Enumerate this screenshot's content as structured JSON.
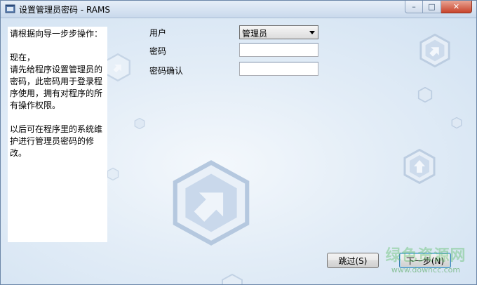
{
  "window": {
    "title": "设置管理员密码 - RAMS",
    "minimize_glyph": "–",
    "maximize_glyph": "□",
    "close_glyph": "✕"
  },
  "instructions": {
    "line1": "请根据向导一步步操作：",
    "line2": "现在，\n请先给程序设置管理员的密码，此密码用于登录程序使用，拥有对程序的所有操作权限。",
    "line3": "以后可在程序里的系统维护进行管理员密码的修改。"
  },
  "form": {
    "user_label": "用户",
    "user_value": "管理员",
    "password_label": "密码",
    "password_value": "",
    "confirm_label": "密码确认",
    "confirm_value": ""
  },
  "buttons": {
    "skip": "跳过(S)",
    "next": "下一步(N)"
  },
  "watermark": {
    "main": "绿色资源网",
    "url": "www.downcc.com"
  },
  "icons": {
    "app": "app-window-icon",
    "background": "hexagon-arrow-decoration-icon"
  }
}
